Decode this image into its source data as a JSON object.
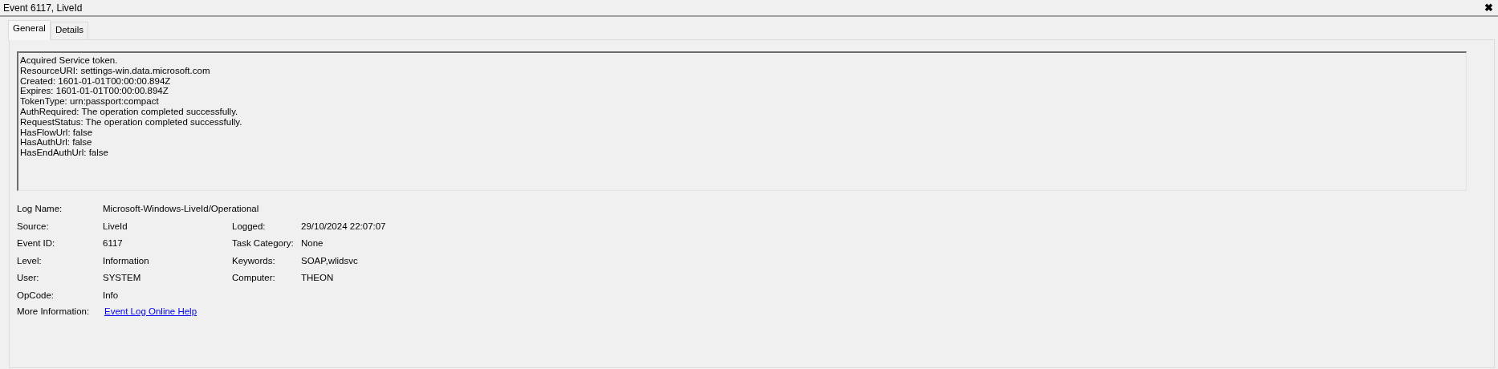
{
  "window": {
    "title": "Event 6117, LiveId",
    "close": "✖"
  },
  "tabs": [
    {
      "label": "General",
      "selected": true
    },
    {
      "label": "Details",
      "selected": false
    }
  ],
  "message": [
    "Acquired Service token.",
    "ResourceURI: settings-win.data.microsoft.com",
    "Created: 1601-01-01T00:00:00.894Z",
    "Expires: 1601-01-01T00:00:00.894Z",
    "TokenType: urn:passport:compact",
    "AuthRequired: The operation completed successfully.",
    "RequestStatus: The operation completed successfully.",
    "HasFlowUrl: false",
    "HasAuthUrl: false",
    "HasEndAuthUrl: false"
  ],
  "details": [
    {
      "fields": [
        {
          "label": "Log Name:",
          "value": "Microsoft-Windows-LiveId/Operational"
        }
      ]
    },
    {
      "fields": [
        {
          "label": "Source:",
          "value": "LiveId"
        },
        {
          "label": "Logged:",
          "value": "29/10/2024 22:07:07"
        }
      ]
    },
    {
      "fields": [
        {
          "label": "Event ID:",
          "value": "6117"
        },
        {
          "label": "Task Category:",
          "value": "None"
        }
      ]
    },
    {
      "fields": [
        {
          "label": "Level:",
          "value": "Information"
        },
        {
          "label": "Keywords:",
          "value": "SOAP,wlidsvc"
        }
      ]
    },
    {
      "fields": [
        {
          "label": "User:",
          "value": "SYSTEM"
        },
        {
          "label": "Computer:",
          "value": "THEON"
        }
      ]
    },
    {
      "fields": [
        {
          "label": "OpCode:",
          "value": "Info"
        }
      ]
    }
  ],
  "more_information": {
    "label": "More Information:",
    "link": "Event Log Online Help"
  }
}
